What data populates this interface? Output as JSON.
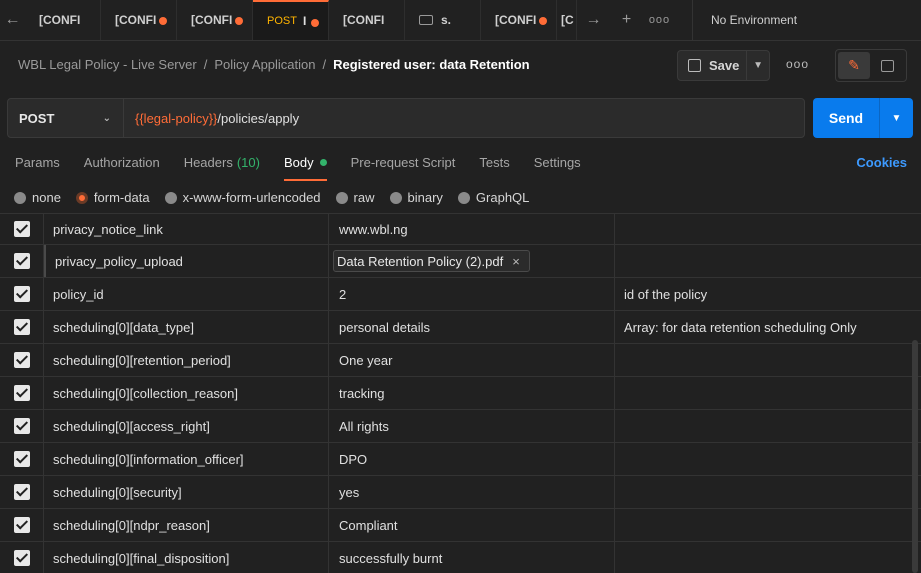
{
  "tabs": [
    {
      "method": "",
      "label": "[CONFI",
      "unsaved": false,
      "active": false
    },
    {
      "method": "",
      "label": "[CONFI",
      "unsaved": true,
      "active": false
    },
    {
      "method": "",
      "label": "[CONFI",
      "unsaved": true,
      "active": false
    },
    {
      "method": "POST",
      "label": "I",
      "unsaved": true,
      "active": true
    },
    {
      "method": "",
      "label": "[CONFI",
      "unsaved": false,
      "active": false
    },
    {
      "method": "",
      "label": "s.",
      "unsaved": false,
      "active": false,
      "icon": "websocket-icon"
    },
    {
      "method": "",
      "label": "[CONFI",
      "unsaved": true,
      "active": false
    },
    {
      "method": "",
      "label": "[C",
      "unsaved": false,
      "active": false
    }
  ],
  "environment": "No Environment",
  "breadcrumb": {
    "collection": "WBL Legal Policy - Live Server",
    "folder": "Policy Application",
    "request": "Registered user: data Retention"
  },
  "toolbar": {
    "save_label": "Save",
    "more_label": "ooo"
  },
  "request": {
    "method": "POST",
    "url_var": "{{legal-policy}}",
    "url_path": "/policies/apply",
    "send_label": "Send"
  },
  "request_tabs": {
    "params": "Params",
    "authorization": "Authorization",
    "headers": "Headers",
    "headers_count": "(10)",
    "body": "Body",
    "prerequest": "Pre-request Script",
    "tests": "Tests",
    "settings": "Settings",
    "cookies": "Cookies"
  },
  "body_types": {
    "none": "none",
    "form_data": "form-data",
    "urlencoded": "x-www-form-urlencoded",
    "raw": "raw",
    "binary": "binary",
    "graphql": "GraphQL"
  },
  "rows": [
    {
      "key": "privacy_notice_link",
      "value": "www.wbl.ng",
      "description": ""
    },
    {
      "key": "privacy_policy_upload",
      "value": "Data Retention Policy (2).pdf",
      "description": "",
      "file": true
    },
    {
      "key": "policy_id",
      "value": "2",
      "description": "id of the policy"
    },
    {
      "key": "scheduling[0][data_type]",
      "value": "personal details",
      "description": "Array: for data retention scheduling Only"
    },
    {
      "key": "scheduling[0][retention_period]",
      "value": "One year",
      "description": ""
    },
    {
      "key": "scheduling[0][collection_reason]",
      "value": "tracking",
      "description": ""
    },
    {
      "key": "scheduling[0][access_right]",
      "value": "All rights",
      "description": ""
    },
    {
      "key": "scheduling[0][information_officer]",
      "value": "DPO",
      "description": ""
    },
    {
      "key": "scheduling[0][security]",
      "value": "yes",
      "description": ""
    },
    {
      "key": "scheduling[0][ndpr_reason]",
      "value": "Compliant",
      "description": ""
    },
    {
      "key": "scheduling[0][final_disposition]",
      "value": "successfully burnt",
      "description": ""
    }
  ],
  "colors": {
    "accent": "#ff6c37",
    "send": "#097bed",
    "link": "#3d9aff",
    "success": "#33b36b",
    "variable": "#ff6c37"
  }
}
